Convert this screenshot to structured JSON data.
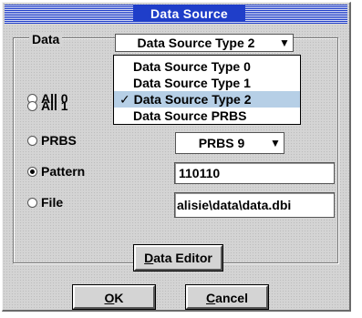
{
  "window": {
    "title": "Data Source"
  },
  "group": {
    "label": "Data"
  },
  "source_type": {
    "value": "Data Source Type 2",
    "options": [
      "Data Source Type 0",
      "Data Source Type 1",
      "Data Source Type 2",
      "Data Source PRBS"
    ],
    "checked_mark": "✓"
  },
  "radios": [
    {
      "label": "All 0",
      "checked": false
    },
    {
      "label": "All 1",
      "checked": false
    },
    {
      "label": "PRBS",
      "checked": false
    },
    {
      "label": "Pattern",
      "checked": true
    },
    {
      "label": "File",
      "checked": false
    }
  ],
  "prbs": {
    "value": "PRBS 9"
  },
  "pattern": {
    "value": "110110"
  },
  "file": {
    "value": "alisie\\data\\data.dbi"
  },
  "buttons": {
    "data_editor": {
      "underline": "D",
      "rest": "ata Editor"
    },
    "ok": {
      "underline": "O",
      "rest": "K"
    },
    "cancel": {
      "underline": "C",
      "rest": "ancel"
    }
  },
  "icons": {
    "dropdown_arrow": "▼"
  }
}
